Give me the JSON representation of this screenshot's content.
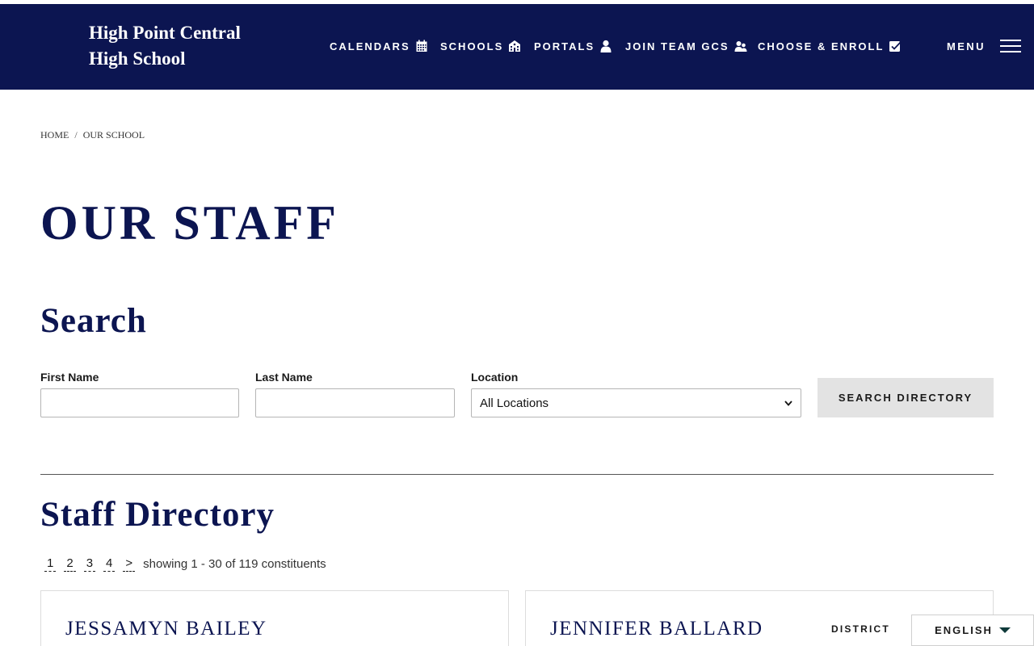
{
  "header": {
    "site_title_line1": "High Point Central",
    "site_title_line2": "High School",
    "nav": [
      {
        "label": "CALENDARS",
        "icon": "calendar-icon"
      },
      {
        "label": "SCHOOLS",
        "icon": "school-icon"
      },
      {
        "label": "PORTALS",
        "icon": "user-icon"
      },
      {
        "label": "JOIN TEAM GCS",
        "icon": "users-icon"
      },
      {
        "label": "CHOOSE & ENROLL",
        "icon": "checkbox-icon"
      }
    ],
    "menu_label": "MENU"
  },
  "breadcrumb": {
    "home": "HOME",
    "separator": "/",
    "current": "OUR SCHOOL"
  },
  "page_title": "OUR STAFF",
  "search": {
    "heading": "Search",
    "first_name_label": "First Name",
    "first_name_value": "",
    "last_name_label": "Last Name",
    "last_name_value": "",
    "location_label": "Location",
    "location_value": "All Locations",
    "button_label": "SEARCH DIRECTORY"
  },
  "directory": {
    "heading": "Staff Directory",
    "pages": [
      "1",
      "2",
      "3",
      "4",
      ">"
    ],
    "count_text": "showing 1 - 30 of 119 constituents",
    "cards": [
      {
        "name": "JESSAMYN BAILEY",
        "tag": ""
      },
      {
        "name": "JENNIFER BALLARD",
        "tag": "DISTRICT"
      }
    ]
  },
  "language": {
    "label": "ENGLISH"
  },
  "colors": {
    "brand_navy": "#0c1551",
    "button_gray": "#e3e3e3"
  }
}
